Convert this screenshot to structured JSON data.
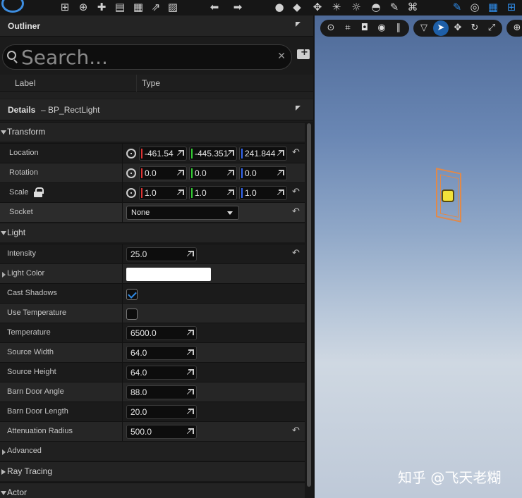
{
  "outliner": {
    "title": "Outliner",
    "search_placeholder": "Search...",
    "columns": [
      "Label",
      "Type"
    ]
  },
  "details": {
    "title": "Details",
    "dash": "–",
    "subject": "BP_RectLight",
    "sections": {
      "transform": "Transform",
      "light": "Light",
      "advanced": "Advanced",
      "ray_tracing": "Ray Tracing",
      "actor": "Actor"
    },
    "transform": {
      "location": {
        "label": "Location",
        "x": "-461.54",
        "y": "-445.351",
        "z": "241.844"
      },
      "rotation": {
        "label": "Rotation",
        "x": "0.0",
        "y": "0.0",
        "z": "0.0"
      },
      "scale": {
        "label": "Scale",
        "x": "1.0",
        "y": "1.0",
        "z": "1.0"
      },
      "socket": {
        "label": "Socket",
        "value": "None"
      }
    },
    "light": {
      "intensity": {
        "label": "Intensity",
        "value": "25.0"
      },
      "light_color": {
        "label": "Light Color",
        "color": "#ffffff"
      },
      "cast_shadows": {
        "label": "Cast Shadows",
        "checked": true
      },
      "use_temperature": {
        "label": "Use Temperature",
        "checked": false
      },
      "temperature": {
        "label": "Temperature",
        "value": "6500.0"
      },
      "source_width": {
        "label": "Source Width",
        "value": "64.0"
      },
      "source_height": {
        "label": "Source Height",
        "value": "64.0"
      },
      "barn_door_angle": {
        "label": "Barn Door Angle",
        "value": "88.0"
      },
      "barn_door_length": {
        "label": "Barn Door Length",
        "value": "20.0"
      },
      "attenuation_radius": {
        "label": "Attenuation Radius",
        "value": "500.0"
      }
    }
  },
  "viewport": {
    "watermark": "知乎 @飞天老糊"
  },
  "colors": {
    "accent": "#2f8be8",
    "x_axis": "#dd3333",
    "y_axis": "#33cc33",
    "z_axis": "#3366ee",
    "light_outline": "#e0894a"
  }
}
